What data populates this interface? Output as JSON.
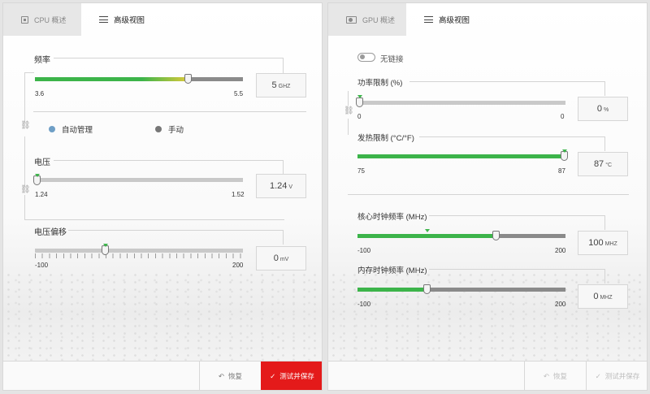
{
  "cpu": {
    "tabs": {
      "overview": "CPU 概述",
      "advanced": "高级视图"
    },
    "frequency": {
      "label": "频率",
      "min": "3.6",
      "max": "5.5",
      "value": "5",
      "unit": "GHZ",
      "position": 0.74
    },
    "mode": {
      "auto": "自动管理",
      "manual": "手动"
    },
    "voltage": {
      "label": "电压",
      "min": "1.24",
      "max": "1.52",
      "value": "1.24",
      "unit": "V",
      "position": 0.0
    },
    "offset": {
      "label": "电压偏移",
      "min": "-100",
      "max": "200",
      "value": "0",
      "unit": "mV",
      "position": 0.333
    },
    "footer": {
      "reset": "恢复",
      "apply": "测试并保存"
    }
  },
  "gpu": {
    "tabs": {
      "overview": "GPU 概述",
      "advanced": "高级视图"
    },
    "link_toggle": "无链接",
    "power_limit": {
      "label": "功率限制 (%)",
      "min": "0",
      "max": "0",
      "value": "0",
      "unit": "%",
      "position": 0.0
    },
    "thermal_limit": {
      "label": "发热限制 (°C/°F)",
      "min": "75",
      "max": "87",
      "value": "87",
      "unit": "°C",
      "position": 1.0
    },
    "core_clock": {
      "label": "核心时钟频率 (MHz)",
      "min": "-100",
      "max": "200",
      "value": "100",
      "unit": "MHZ",
      "position": 0.667,
      "default_position": 0.333
    },
    "memory_clock": {
      "label": "内存时钟频率 (MHz)",
      "min": "-100",
      "max": "200",
      "value": "0",
      "unit": "MHZ",
      "position": 0.333
    },
    "footer": {
      "reset": "恢复",
      "apply": "测试并保存"
    }
  },
  "colors": {
    "green": "#3cb44a",
    "yellow": "#d9c93a",
    "red": "#e41a1a",
    "grey": "#8a8a8a",
    "auto_dot": "#6f9fc6",
    "manual_dot": "#777777"
  },
  "icons": [
    "cpu-chip-icon",
    "gpu-card-icon",
    "sliders-icon",
    "link-icon",
    "undo-icon",
    "check-icon"
  ]
}
